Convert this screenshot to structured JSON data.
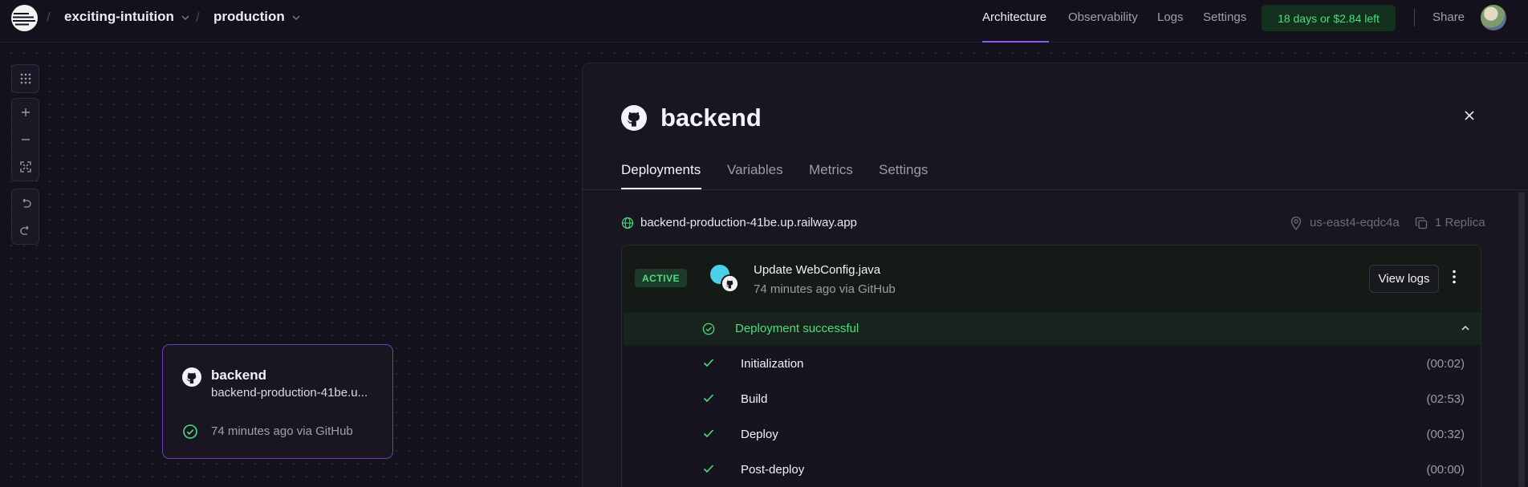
{
  "header": {
    "project": "exciting-intuition",
    "environment": "production",
    "nav": [
      "Architecture",
      "Observability",
      "Logs",
      "Settings"
    ],
    "active_nav": "Architecture",
    "trial": "18 days or $2.84 left",
    "share": "Share"
  },
  "canvas_card": {
    "name": "backend",
    "url": "backend-production-41be.u...",
    "status": "74 minutes ago via GitHub"
  },
  "panel": {
    "title": "backend",
    "tabs": [
      "Deployments",
      "Variables",
      "Metrics",
      "Settings"
    ],
    "active_tab": "Deployments",
    "domain": "backend-production-41be.up.railway.app",
    "region": "us-east4-eqdc4a",
    "replicas": "1 Replica",
    "deployment": {
      "badge": "ACTIVE",
      "commit": "Update WebConfig.java",
      "meta": "74 minutes ago via GitHub",
      "view_logs": "View logs",
      "status": "Deployment successful",
      "steps": [
        {
          "name": "Initialization",
          "time": "(00:02)"
        },
        {
          "name": "Build",
          "time": "(02:53)"
        },
        {
          "name": "Deploy",
          "time": "(00:32)"
        },
        {
          "name": "Post-deploy",
          "time": "(00:00)"
        }
      ]
    }
  },
  "colors": {
    "accent": "#8b5cf6",
    "success": "#4ade80",
    "background": "#13111c"
  }
}
